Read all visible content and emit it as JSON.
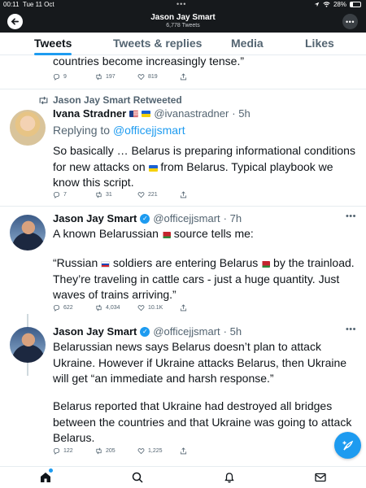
{
  "status_bar": {
    "time": "00:11",
    "date": "Tue 11 Oct",
    "battery": "28%",
    "battery_level": 0.28
  },
  "header": {
    "name": "Jason Jay Smart",
    "tweet_count": "6,778 Tweets"
  },
  "tabs": [
    {
      "label": "Tweets",
      "active": true
    },
    {
      "label": "Tweets & replies",
      "active": false
    },
    {
      "label": "Media",
      "active": false
    },
    {
      "label": "Likes",
      "active": false
    }
  ],
  "partial_tweet": {
    "text": "countries become increasingly tense.”",
    "replies": "9",
    "retweets": "197",
    "likes": "819"
  },
  "retweet_label": "Jason Jay Smart Retweeted",
  "tweets": [
    {
      "name": "Ivana Stradner",
      "handle": "@ivanastradner",
      "time": "· 5h",
      "replying_prefix": "Replying to ",
      "replying_to": "@officejjsmart",
      "text_1": "So basically … Belarus is preparing informational conditions for new attacks on ",
      "text_2": " from Belarus. Typical playbook we know this script.",
      "replies": "7",
      "retweets": "31",
      "likes": "221"
    },
    {
      "name": "Jason Jay Smart",
      "handle": "@officejjsmart",
      "time": "· 7h",
      "line1_a": "A known Belarussian ",
      "line1_b": " source tells me:",
      "quote_a": "“Russian ",
      "quote_b": " soldiers are entering Belarus ",
      "quote_c": " by the trainload. They’re traveling in cattle cars - just a huge quantity. Just waves of trains arriving.”",
      "replies": "622",
      "retweets": "4,034",
      "likes": "10.1K"
    },
    {
      "name": "Jason Jay Smart",
      "handle": "@officejjsmart",
      "time": "· 5h",
      "para1": "Belarussian news says Belarus doesn’t plan to attack Ukraine. However if Ukraine attacks Belarus, then Ukraine will get “an immediate and harsh response.”",
      "para2": "Belarus reported that Ukraine had destroyed all bridges between the countries and that Ukraine was going to attack Belarus.",
      "replies": "122",
      "retweets": "205",
      "likes": "1,225"
    }
  ],
  "icons": {
    "back": "arrow-left-icon",
    "more": "more-dots-icon",
    "reply": "reply-icon",
    "retweet": "retweet-icon",
    "like": "heart-icon",
    "share": "share-icon",
    "compose": "compose-feather-icon",
    "home": "home-icon",
    "search": "search-icon",
    "notifications": "bell-icon",
    "messages": "envelope-icon"
  },
  "colors": {
    "accent": "#1d9bf0",
    "text": "#0f1419",
    "secondary": "#536471"
  }
}
